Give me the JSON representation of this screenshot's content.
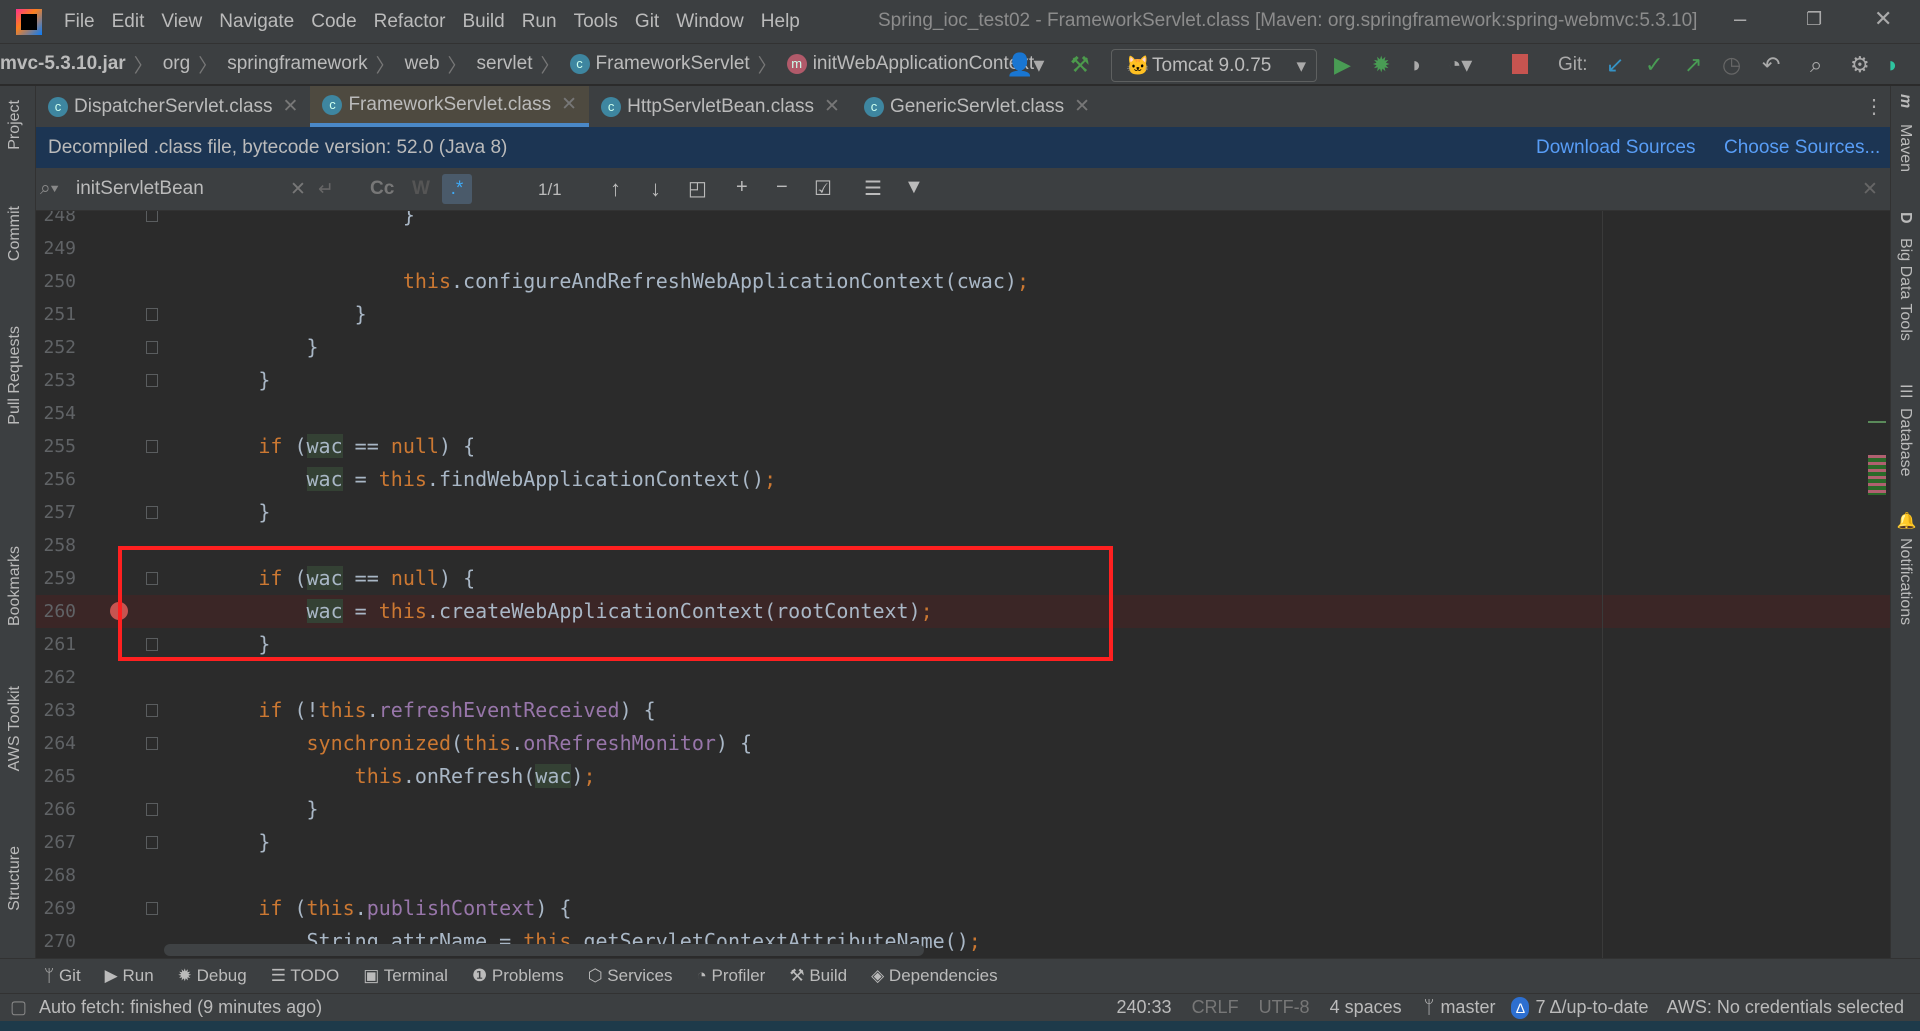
{
  "menubar": {
    "items": [
      "File",
      "Edit",
      "View",
      "Navigate",
      "Code",
      "Refactor",
      "Build",
      "Run",
      "Tools",
      "Git",
      "Window",
      "Help"
    ],
    "title": "Spring_ioc_test02 - FrameworkServlet.class [Maven: org.springframework:spring-webmvc:5.3.10]"
  },
  "breadcrumb": [
    "mvc-5.3.10.jar",
    "org",
    "springframework",
    "web",
    "servlet",
    "FrameworkServlet",
    "initWebApplicationContext"
  ],
  "toolbar": {
    "run_config": "Tomcat 9.0.75",
    "git_label": "Git:"
  },
  "tabs": [
    {
      "label": "DispatcherServlet.class",
      "active": false
    },
    {
      "label": "FrameworkServlet.class",
      "active": true
    },
    {
      "label": "HttpServletBean.class",
      "active": false
    },
    {
      "label": "GenericServlet.class",
      "active": false
    }
  ],
  "banner": {
    "text": "Decompiled .class file, bytecode version: 52.0 (Java 8)",
    "download": "Download Sources",
    "choose": "Choose Sources..."
  },
  "search": {
    "value": "initServletBean",
    "case_label": "Cc",
    "word_label": "W",
    "regex_label": ".*",
    "count": "1/1"
  },
  "left_stripe": [
    "Project",
    "Commit",
    "Pull Requests",
    "Bookmarks",
    "AWS Toolkit",
    "Structure"
  ],
  "right_stripe": [
    "Maven",
    "Big Data Tools",
    "Database",
    "Notifications"
  ],
  "editor": {
    "breakpoint_line": "260",
    "lines": [
      {
        "num": "248",
        "tokens": [
          [
            "                    }",
            "t"
          ]
        ]
      },
      {
        "num": "249",
        "tokens": []
      },
      {
        "num": "250",
        "tokens": [
          [
            "                    ",
            "t"
          ],
          [
            "this",
            "k"
          ],
          [
            ".configureAndRefreshWebApplicationContext(cwac)",
            "t"
          ],
          [
            ";",
            "k"
          ]
        ]
      },
      {
        "num": "251",
        "tokens": [
          [
            "                }",
            "t"
          ]
        ]
      },
      {
        "num": "252",
        "tokens": [
          [
            "            }",
            "t"
          ]
        ]
      },
      {
        "num": "253",
        "tokens": [
          [
            "        }",
            "t"
          ]
        ]
      },
      {
        "num": "254",
        "tokens": []
      },
      {
        "num": "255",
        "tokens": [
          [
            "        ",
            "t"
          ],
          [
            "if",
            "k"
          ],
          [
            " (",
            "t"
          ],
          [
            "wac",
            "h"
          ],
          [
            " == ",
            "t"
          ],
          [
            "null",
            "k"
          ],
          [
            ") {",
            "t"
          ]
        ]
      },
      {
        "num": "256",
        "tokens": [
          [
            "            ",
            "t"
          ],
          [
            "wac",
            "h"
          ],
          [
            " = ",
            "t"
          ],
          [
            "this",
            "k"
          ],
          [
            ".findWebApplicationContext()",
            "t"
          ],
          [
            ";",
            "k"
          ]
        ]
      },
      {
        "num": "257",
        "tokens": [
          [
            "        }",
            "t"
          ]
        ]
      },
      {
        "num": "258",
        "tokens": []
      },
      {
        "num": "259",
        "tokens": [
          [
            "        ",
            "t"
          ],
          [
            "if",
            "k"
          ],
          [
            " (",
            "t"
          ],
          [
            "wac",
            "h"
          ],
          [
            " == ",
            "t"
          ],
          [
            "null",
            "k"
          ],
          [
            ") {",
            "t"
          ]
        ]
      },
      {
        "num": "260",
        "tokens": [
          [
            "            ",
            "t"
          ],
          [
            "wac",
            "h"
          ],
          [
            " = ",
            "t"
          ],
          [
            "this",
            "k"
          ],
          [
            ".createWebApplicationContext(rootContext)",
            "t"
          ],
          [
            ";",
            "k"
          ]
        ]
      },
      {
        "num": "261",
        "tokens": [
          [
            "        }",
            "t"
          ]
        ]
      },
      {
        "num": "262",
        "tokens": []
      },
      {
        "num": "263",
        "tokens": [
          [
            "        ",
            "t"
          ],
          [
            "if",
            "k"
          ],
          [
            " (!",
            "t"
          ],
          [
            "this",
            "k"
          ],
          [
            ".",
            "t"
          ],
          [
            "refreshEventReceived",
            "f"
          ],
          [
            ") {",
            "t"
          ]
        ]
      },
      {
        "num": "264",
        "tokens": [
          [
            "            ",
            "t"
          ],
          [
            "synchronized",
            "k"
          ],
          [
            "(",
            "t"
          ],
          [
            "this",
            "k"
          ],
          [
            ".",
            "t"
          ],
          [
            "onRefreshMonitor",
            "f"
          ],
          [
            ") {",
            "t"
          ]
        ]
      },
      {
        "num": "265",
        "tokens": [
          [
            "                ",
            "t"
          ],
          [
            "this",
            "k"
          ],
          [
            ".onRefresh(",
            "t"
          ],
          [
            "wac",
            "h"
          ],
          [
            ")",
            "t"
          ],
          [
            ";",
            "k"
          ]
        ]
      },
      {
        "num": "266",
        "tokens": [
          [
            "            }",
            "t"
          ]
        ]
      },
      {
        "num": "267",
        "tokens": [
          [
            "        }",
            "t"
          ]
        ]
      },
      {
        "num": "268",
        "tokens": []
      },
      {
        "num": "269",
        "tokens": [
          [
            "        ",
            "t"
          ],
          [
            "if",
            "k"
          ],
          [
            " (",
            "t"
          ],
          [
            "this",
            "k"
          ],
          [
            ".",
            "t"
          ],
          [
            "publishContext",
            "f"
          ],
          [
            ") {",
            "t"
          ]
        ]
      },
      {
        "num": "270",
        "tokens": [
          [
            "            String attrName = ",
            "t"
          ],
          [
            "this",
            "k"
          ],
          [
            ".getServletContextAttributeName()",
            "t"
          ],
          [
            ";",
            "k"
          ]
        ]
      }
    ]
  },
  "toolwindows": [
    "Git",
    "Run",
    "Debug",
    "TODO",
    "Terminal",
    "Problems",
    "Services",
    "Profiler",
    "Build",
    "Dependencies"
  ],
  "status": {
    "message": "Auto fetch: finished (9 minutes ago)",
    "position": "240:33",
    "line_sep": "CRLF",
    "encoding": "UTF-8",
    "indent": "4 spaces",
    "branch": "master",
    "updates": "7 Δ/up-to-date",
    "aws": "AWS: No credentials selected"
  },
  "colors": {
    "highlight_box": "#ff2020",
    "keyword": "#cc7832",
    "field": "#9876aa",
    "banner_bg": "#1c3553",
    "link": "#589df6"
  }
}
